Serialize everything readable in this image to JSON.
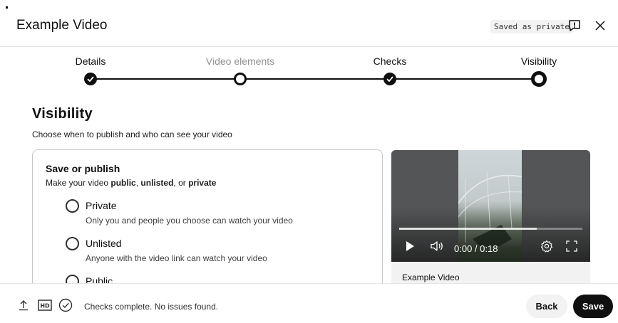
{
  "header": {
    "title": "Example Video",
    "saved_status": "Saved as private",
    "feedback_icon": "feedback-icon",
    "close_icon": "close-icon"
  },
  "stepper": {
    "steps": [
      {
        "label": "Details",
        "state": "done"
      },
      {
        "label": "Video elements",
        "state": "pending"
      },
      {
        "label": "Checks",
        "state": "done"
      },
      {
        "label": "Visibility",
        "state": "current"
      }
    ]
  },
  "visibility": {
    "title": "Visibility",
    "subtitle": "Choose when to publish and who can see your video",
    "card": {
      "title": "Save or publish",
      "desc_prefix": "Make your video ",
      "desc_public": "public",
      "desc_sep1": ", ",
      "desc_unlisted": "unlisted",
      "desc_sep2": ", or ",
      "desc_private": "private",
      "options": [
        {
          "label": "Private",
          "description": "Only you and people you choose can watch your video",
          "selected": false
        },
        {
          "label": "Unlisted",
          "description": "Anyone with the video link can watch your video",
          "selected": false
        },
        {
          "label": "Public",
          "description": "",
          "selected": false
        }
      ]
    }
  },
  "video": {
    "time": "0:00 / 0:18",
    "progress": 0.75,
    "caption": "Example Video",
    "controls": [
      "play-icon",
      "volume-icon",
      "settings-icon",
      "fullscreen-icon"
    ]
  },
  "footer": {
    "status": "Checks complete. No issues found.",
    "icons": [
      "upload-icon",
      "hd-icon",
      "check-circle-icon"
    ],
    "back_label": "Back",
    "save_label": "Save"
  },
  "colors": {
    "primary": "#0f0f0f",
    "muted_text": "#909090",
    "badge_bg": "#f2f2f2"
  }
}
